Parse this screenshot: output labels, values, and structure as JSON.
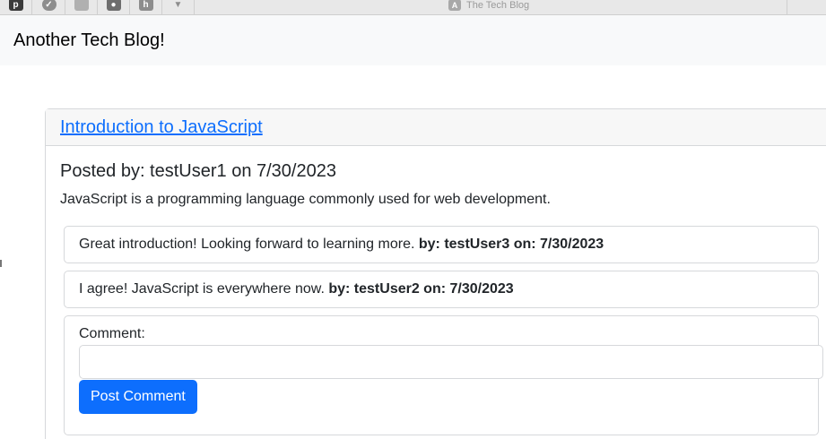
{
  "browser": {
    "toolbar_icons": [
      {
        "name": "pinboard-icon",
        "glyph": "p",
        "color": "#3a3a3a"
      },
      {
        "name": "pocket-icon",
        "glyph": "✓",
        "color": "#8d8d8d"
      },
      {
        "name": "extension-square-icon",
        "glyph": "",
        "color": "#b0b0b0"
      },
      {
        "name": "ghost-icon",
        "glyph": "●",
        "color": "#6d6d6d"
      },
      {
        "name": "h-extension-icon",
        "glyph": "h",
        "color": "#8d8d8d"
      },
      {
        "name": "filter-icon",
        "glyph": "▼",
        "color": "#8d8d8d"
      }
    ],
    "tab_icon": "A",
    "tab_title": "The Tech Blog"
  },
  "navbar": {
    "brand": "Another Tech Blog!"
  },
  "post": {
    "title": "Introduction to JavaScript",
    "posted_by": "Posted by: testUser1 on 7/30/2023",
    "content": "JavaScript is a programming language commonly used for web development."
  },
  "comments": [
    {
      "text": "Great introduction! Looking forward to learning more.",
      "meta": "by: testUser3 on: 7/30/2023"
    },
    {
      "text": "I agree! JavaScript is everywhere now.",
      "meta": "by: testUser2 on: 7/30/2023"
    }
  ],
  "comment_form": {
    "label": "Comment:",
    "value": "",
    "button_label": "Post Comment"
  },
  "colors": {
    "link": "#0d6efd",
    "button": "#0d6efd",
    "navbar_bg": "#f8f9fa"
  }
}
